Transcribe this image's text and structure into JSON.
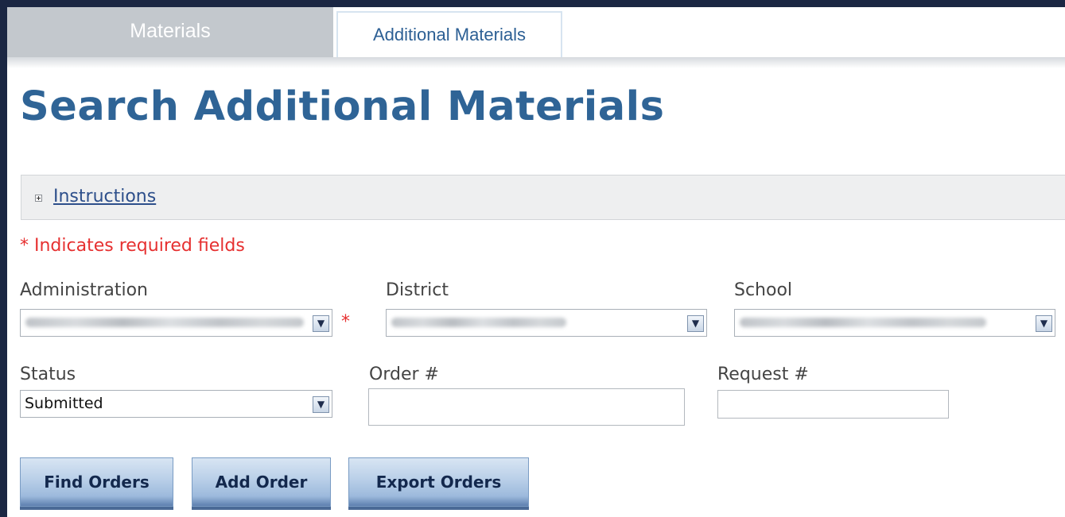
{
  "tabs": {
    "materials": "Materials",
    "additional_materials": "Additional Materials"
  },
  "page": {
    "title": "Search Additional Materials"
  },
  "instructions": {
    "label": "Instructions"
  },
  "required_note": "* Indicates required fields",
  "form": {
    "administration": {
      "label": "Administration",
      "required_marker": "*"
    },
    "district": {
      "label": "District"
    },
    "school": {
      "label": "School"
    },
    "status": {
      "label": "Status",
      "value": "Submitted"
    },
    "order": {
      "label": "Order #",
      "value": ""
    },
    "request": {
      "label": "Request #",
      "value": ""
    }
  },
  "buttons": {
    "find_orders": "Find Orders",
    "add_order": "Add Order",
    "export_orders": "Export Orders"
  },
  "colors": {
    "title": "#2f6496",
    "required": "#e63030",
    "link": "#2d4f8b",
    "frame": "#1b2743"
  }
}
